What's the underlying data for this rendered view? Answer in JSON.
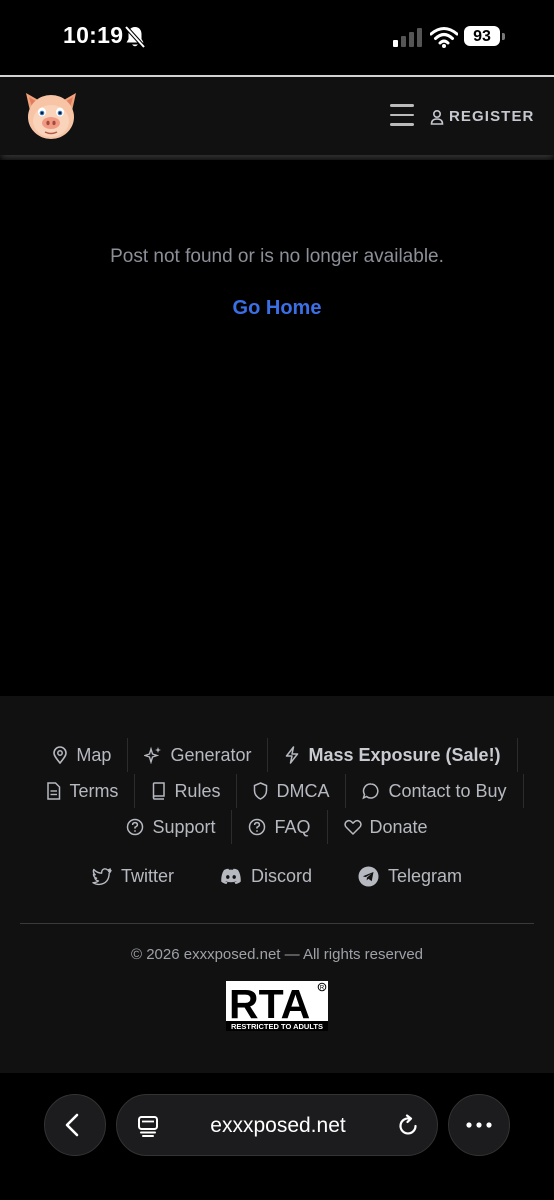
{
  "status_bar": {
    "time": "10:19",
    "battery": "93"
  },
  "header": {
    "logo_icon": "pig-face-icon",
    "menu_icon": "hamburger-icon",
    "register_label": "REGISTER",
    "register_icon": "user-icon"
  },
  "main": {
    "message": "Post not found or is no longer available.",
    "go_home": "Go Home"
  },
  "footer": {
    "row1": [
      {
        "label": "Map",
        "icon": "map-pin-icon"
      },
      {
        "label": "Generator",
        "icon": "sparkles-icon"
      },
      {
        "label": "Mass Exposure (Sale!)",
        "icon": "lightning-icon"
      }
    ],
    "row2": [
      {
        "label": "Terms",
        "icon": "document-icon"
      },
      {
        "label": "Rules",
        "icon": "book-icon"
      },
      {
        "label": "DMCA",
        "icon": "shield-icon"
      },
      {
        "label": "Contact to Buy",
        "icon": "chat-bubble-icon"
      }
    ],
    "row3": [
      {
        "label": "Support",
        "icon": "question-circle-icon"
      },
      {
        "label": "FAQ",
        "icon": "question-circle-icon"
      },
      {
        "label": "Donate",
        "icon": "heart-icon"
      }
    ],
    "social": [
      {
        "label": "Twitter",
        "icon": "twitter-icon"
      },
      {
        "label": "Discord",
        "icon": "discord-icon"
      },
      {
        "label": "Telegram",
        "icon": "telegram-icon"
      }
    ],
    "copyright": "© 2026 exxxposed.net — All rights reserved",
    "rta_logo": {
      "main": "RTA",
      "sub": "RESTRICTED TO ADULTS"
    }
  },
  "browser": {
    "url": "exxxposed.net"
  },
  "colors": {
    "accent": "#3b6fe6",
    "background": "#000000",
    "panel": "#111111"
  }
}
